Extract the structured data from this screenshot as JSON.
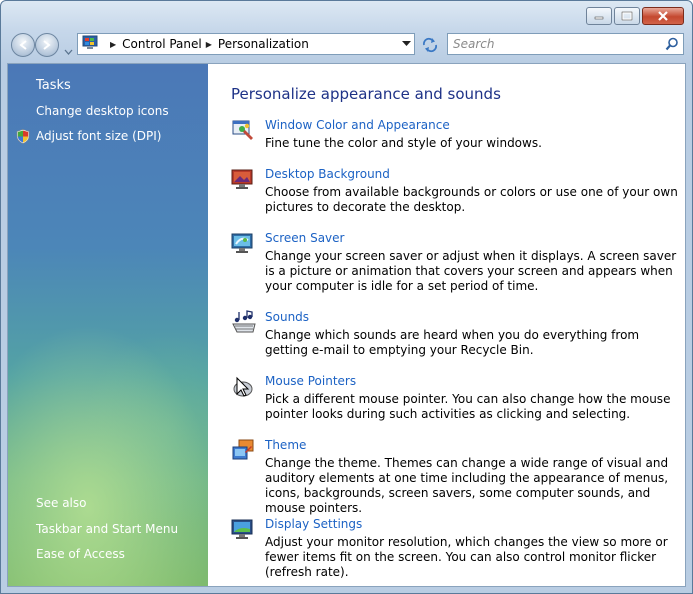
{
  "address": {
    "crumbs": [
      "Control Panel",
      "Personalization"
    ]
  },
  "search": {
    "placeholder": "Search"
  },
  "sidebar": {
    "tasks_heading": "Tasks",
    "tasks": [
      "Change desktop icons",
      "Adjust font size (DPI)"
    ],
    "see_also_heading": "See also",
    "see_also": [
      "Taskbar and Start Menu",
      "Ease of Access"
    ]
  },
  "main": {
    "title": "Personalize appearance and sounds",
    "items": [
      {
        "link": "Window Color and Appearance",
        "desc": "Fine tune the color and style of your windows.",
        "icon": "window-color-icon"
      },
      {
        "link": "Desktop Background",
        "desc": "Choose from available backgrounds or colors or use one of your own pictures to decorate the desktop.",
        "icon": "desktop-background-icon"
      },
      {
        "link": "Screen Saver",
        "desc": "Change your screen saver or adjust when it displays. A screen saver is a picture or animation that covers your screen and appears when your computer is idle for a set period of time.",
        "icon": "screen-saver-icon"
      },
      {
        "link": "Sounds",
        "desc": "Change which sounds are heard when you do everything from getting e-mail to emptying your Recycle Bin.",
        "icon": "sounds-icon"
      },
      {
        "link": "Mouse Pointers",
        "desc": "Pick a different mouse pointer. You can also change how the mouse pointer looks during such activities as clicking and selecting.",
        "icon": "mouse-pointers-icon"
      },
      {
        "link": "Theme",
        "desc": "Change the theme. Themes can change a wide range of visual and auditory elements at one time including the appearance of menus, icons, backgrounds, screen savers, some computer sounds, and mouse pointers.",
        "icon": "theme-icon"
      },
      {
        "link": "Display Settings",
        "desc": "Adjust your monitor resolution, which changes the view so more or fewer items fit on the screen. You can also control monitor flicker (refresh rate).",
        "icon": "display-settings-icon"
      }
    ]
  },
  "colors": {
    "link": "#1c62c4",
    "title": "#1e3287",
    "close_button": "#c4482f"
  }
}
